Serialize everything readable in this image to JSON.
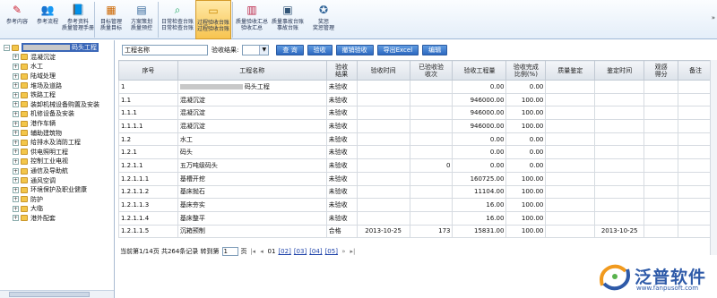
{
  "toolbar": {
    "buttons": [
      {
        "label": "参考内容",
        "icon": "doc-pen-icon"
      },
      {
        "label": "参考流程",
        "icon": "people-icon"
      },
      {
        "label": "参考资料\n质量管理手册",
        "icon": "book-icon"
      },
      {
        "label": "目标管理\n质量目标",
        "icon": "chart-icon"
      },
      {
        "label": "方案策划\n质量预控",
        "icon": "document-icon"
      },
      {
        "label": "日常检查台账\n日常检查台账",
        "icon": "magnifier-icon"
      },
      {
        "label": "过程验收台账\n过程验收台账",
        "icon": "folder-icon"
      },
      {
        "label": "质量验收汇总\n验收汇总",
        "icon": "books-icon"
      },
      {
        "label": "质量事故台账\n事故台账",
        "icon": "ledger-icon"
      },
      {
        "label": "奖惩\n奖惩管理",
        "icon": "award-icon"
      }
    ],
    "active_index": 6,
    "scroll_label": "»"
  },
  "tree": {
    "root_label": "码头工程",
    "items": [
      "混凝沉淀",
      "水工",
      "陆域处理",
      "堆场及道路",
      "铁路工程",
      "装卸机械设备购置及安装",
      "机修设备及安装",
      "港作车辆",
      "辅助建筑物",
      "给排水及消防工程",
      "供电照明工程",
      "控制工业电视",
      "通信及导助航",
      "通风空调",
      "环境保护及职业健康",
      "防护",
      "大临",
      "港外配套"
    ]
  },
  "filter": {
    "name_placeholder": "工程名称",
    "result_label": "验收结果:",
    "buttons": [
      "查 询",
      "验收",
      "撤销验收",
      "导出Excel",
      "编辑"
    ]
  },
  "table": {
    "headers": [
      "序号",
      "工程名称",
      "验收\n结果",
      "验收时间",
      "已验收验\n收次",
      "验收工程量",
      "验收完成\n比例(%)",
      "质量鉴定",
      "鉴定时间",
      "观感\n得分",
      "备注"
    ],
    "rows": [
      [
        "1",
        "码头工程",
        "未验收",
        "",
        "",
        "0.00",
        "0.00",
        "",
        "",
        "",
        ""
      ],
      [
        "1.1",
        "混凝沉淀",
        "未验收",
        "",
        "",
        "946000.00",
        "100.00",
        "",
        "",
        "",
        ""
      ],
      [
        "1.1.1",
        "混凝沉淀",
        "未验收",
        "",
        "",
        "946000.00",
        "100.00",
        "",
        "",
        "",
        ""
      ],
      [
        "1.1.1.1",
        "混凝沉淀",
        "未验收",
        "",
        "",
        "946000.00",
        "100.00",
        "",
        "",
        "",
        ""
      ],
      [
        "1.2",
        "水工",
        "未验收",
        "",
        "",
        "0.00",
        "0.00",
        "",
        "",
        "",
        ""
      ],
      [
        "1.2.1",
        "码头",
        "未验收",
        "",
        "",
        "0.00",
        "0.00",
        "",
        "",
        "",
        ""
      ],
      [
        "1.2.1.1",
        "五万吨级码头",
        "未验收",
        "",
        "0",
        "0.00",
        "0.00",
        "",
        "",
        "",
        ""
      ],
      [
        "1.2.1.1.1",
        "基槽开挖",
        "未验收",
        "",
        "",
        "160725.00",
        "100.00",
        "",
        "",
        "",
        ""
      ],
      [
        "1.2.1.1.2",
        "基床抛石",
        "未验收",
        "",
        "",
        "11104.00",
        "100.00",
        "",
        "",
        "",
        ""
      ],
      [
        "1.2.1.1.3",
        "基床夯实",
        "未验收",
        "",
        "",
        "16.00",
        "100.00",
        "",
        "",
        "",
        ""
      ],
      [
        "1.2.1.1.4",
        "基床整平",
        "未验收",
        "",
        "",
        "16.00",
        "100.00",
        "",
        "",
        "",
        ""
      ],
      [
        "1.2.1.1.5",
        "沉箱预制",
        "合格",
        "2013-10-25",
        "173",
        "15831.00",
        "100.00",
        "",
        "2013-10-25",
        "",
        ""
      ]
    ]
  },
  "pager": {
    "summary": "当前第1/14页 共264条记录 转到第",
    "page_input": "1",
    "page_suffix": "页",
    "pages": [
      "01",
      "[02]",
      "[03]",
      "[04]",
      "[05]"
    ],
    "next": "»"
  },
  "logo": {
    "name": "泛普软件",
    "url": "www.fanpusoft.com"
  }
}
